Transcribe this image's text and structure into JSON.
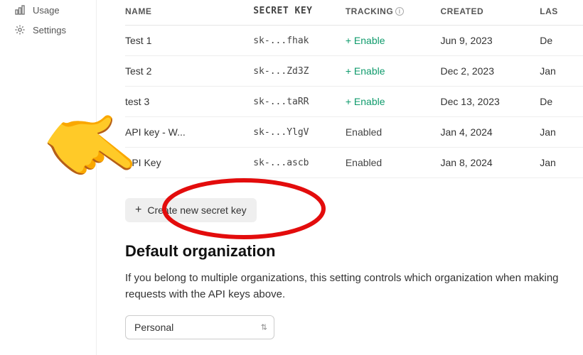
{
  "sidebar": {
    "items": [
      {
        "label": "Usage",
        "icon": "usage-icon"
      },
      {
        "label": "Settings",
        "icon": "gear-icon"
      }
    ]
  },
  "table": {
    "headers": {
      "name": "NAME",
      "secret": "SECRET KEY",
      "tracking": "TRACKING",
      "created": "CREATED",
      "last": "LAS"
    },
    "rows": [
      {
        "name": "Test 1",
        "secret": "sk-...fhak",
        "tracking": "+ Enable",
        "tracking_state": "link",
        "created": "Jun 9, 2023",
        "last": "De"
      },
      {
        "name": "Test 2",
        "secret": "sk-...Zd3Z",
        "tracking": "+ Enable",
        "tracking_state": "link",
        "created": "Dec 2, 2023",
        "last": "Jan"
      },
      {
        "name": "test 3",
        "secret": "sk-...taRR",
        "tracking": "+ Enable",
        "tracking_state": "link",
        "created": "Dec 13, 2023",
        "last": "De"
      },
      {
        "name": "API key          - W...",
        "secret": "sk-...YlgV",
        "tracking": "Enabled",
        "tracking_state": "text",
        "created": "Jan 4, 2024",
        "last": "Jan"
      },
      {
        "name": "API Key",
        "secret": "sk-...ascb",
        "tracking": "Enabled",
        "tracking_state": "text",
        "created": "Jan 8, 2024",
        "last": "Jan"
      }
    ]
  },
  "create_button": {
    "label": "Create new secret key"
  },
  "default_org": {
    "heading": "Default organization",
    "description": "If you belong to multiple organizations, this setting controls which organization when making requests with the API keys above.",
    "selected": "Personal"
  },
  "colors": {
    "accent_green": "#0f9b6c",
    "annotation_red": "#e30c0c"
  }
}
